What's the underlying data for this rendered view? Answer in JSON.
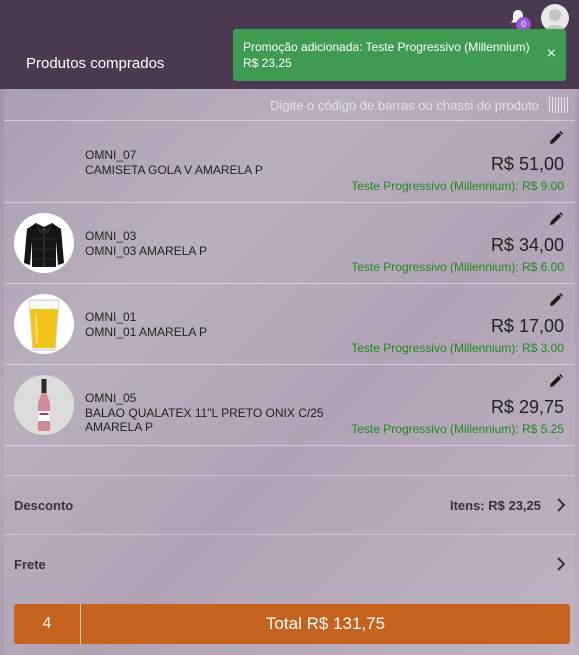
{
  "header": {
    "title": "Produtos comprados",
    "notification_count": "0"
  },
  "toast": {
    "line1": "Promoção adicionada: Teste Progressivo (Millennium)",
    "line2": "R$ 23,25",
    "close_label": "×"
  },
  "search": {
    "placeholder": "Digite o código de barras ou chassi do produto"
  },
  "items": [
    {
      "code": "OMNI_07",
      "desc": "CAMISETA GOLA V AMARELA P",
      "price": "R$ 51,00",
      "promo": "Teste Progressivo (Millennium): R$ 9.00",
      "image": "none"
    },
    {
      "code": "OMNI_03",
      "desc": "OMNI_03 AMARELA P",
      "price": "R$ 34,00",
      "promo": "Teste Progressivo (Millennium): R$ 6.00",
      "image": "jacket"
    },
    {
      "code": "OMNI_01",
      "desc": "OMNI_01 AMARELA P",
      "price": "R$ 17,00",
      "promo": "Teste Progressivo (Millennium): R$ 3.00",
      "image": "beer-glass"
    },
    {
      "code": "OMNI_05",
      "desc": "BALAO QUALATEX 11\"L PRETO ONIX C/25 AMARELA P",
      "price": "R$ 29,75",
      "promo": "Teste Progressivo (Millennium): R$ 5.25",
      "image": "bottle"
    }
  ],
  "discount": {
    "label": "Desconto",
    "value": "Itens: R$ 23,25"
  },
  "shipping": {
    "label": "Frete"
  },
  "checkout": {
    "count": "4",
    "total": "Total R$ 131,75"
  },
  "colors": {
    "header_bg": "#4a3a50",
    "toast_bg": "#3f9a52",
    "promo_text": "#1c8a1c",
    "checkout_bg": "#c5621e",
    "badge_bg": "#9c55d6"
  }
}
